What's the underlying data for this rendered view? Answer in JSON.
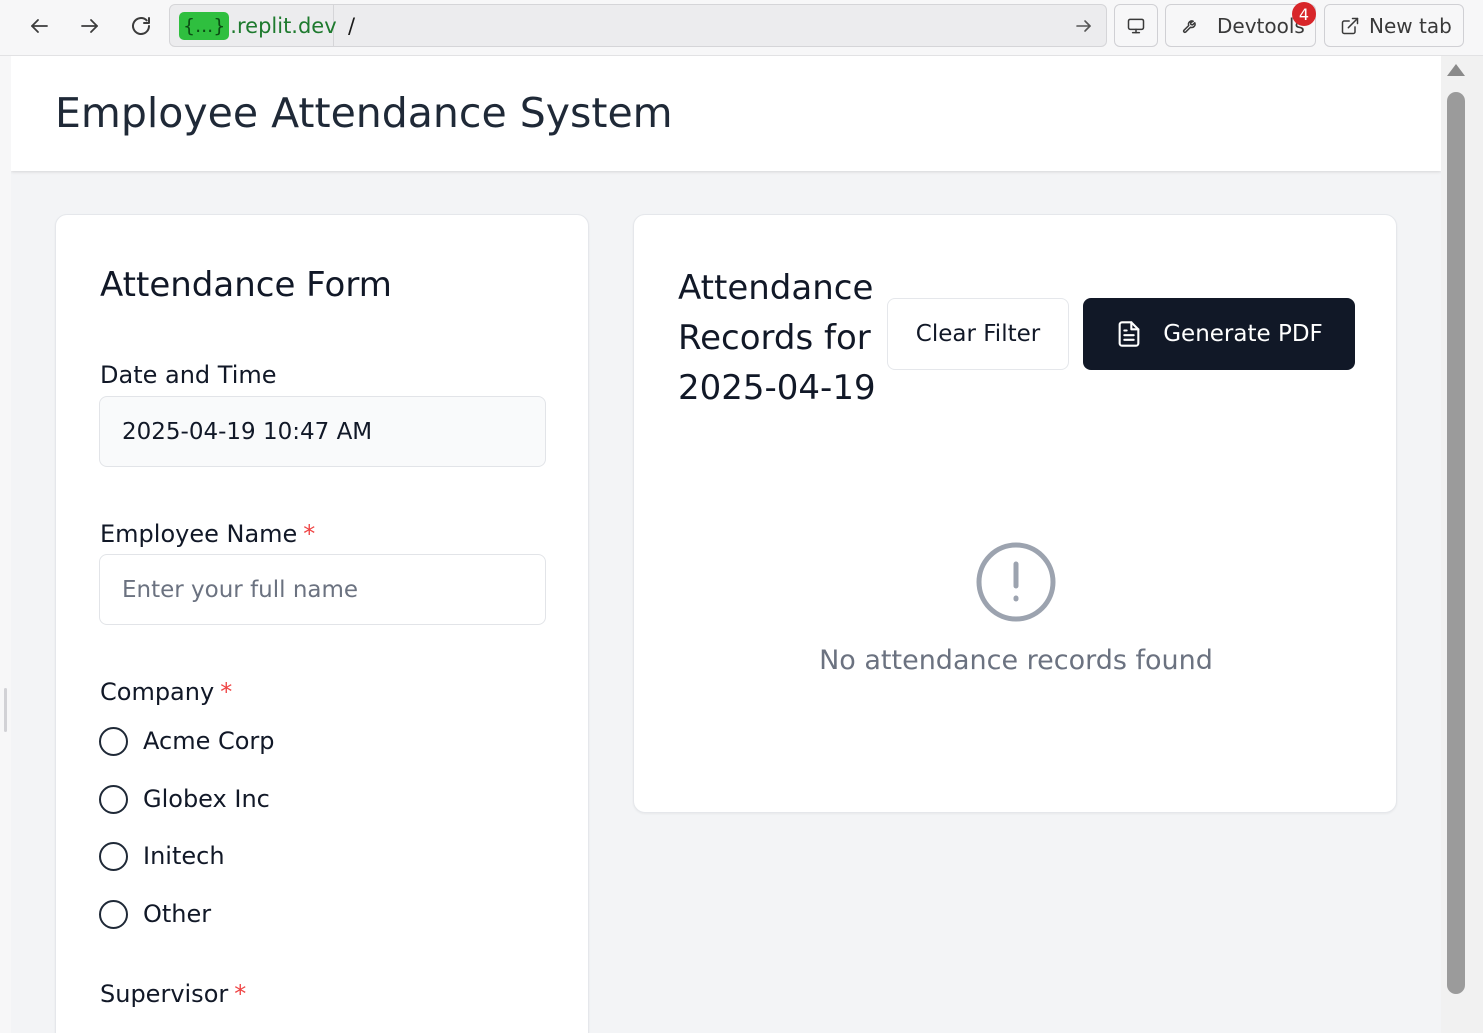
{
  "browser": {
    "url_badge": "{...}",
    "url_host": ".replit.dev",
    "url_path": "/",
    "devtools_label": "Devtools",
    "devtools_badge": "4",
    "new_tab_label": "New tab"
  },
  "app": {
    "title": "Employee Attendance System"
  },
  "form": {
    "heading": "Attendance Form",
    "datetime_label": "Date and Time",
    "datetime_value": "2025-04-19 10:47 AM",
    "name_label": "Employee Name",
    "name_placeholder": "Enter your full name",
    "required_mark": "*",
    "company_label": "Company",
    "company_options": [
      "Acme Corp",
      "Globex Inc",
      "Initech",
      "Other"
    ],
    "supervisor_label": "Supervisor"
  },
  "records": {
    "heading": "Attendance Records for 2025-04-19",
    "clear_filter_label": "Clear Filter",
    "generate_pdf_label": "Generate PDF",
    "empty_message": "No attendance records found"
  },
  "colors": {
    "accent_dark": "#111827",
    "required": "#ef4444",
    "badge_red": "#d8262a",
    "url_badge_green": "#2fbf3f"
  },
  "icons": {
    "back": "arrow-left-icon",
    "forward": "arrow-right-icon",
    "reload": "reload-icon",
    "go": "arrow-right-small-icon",
    "screen": "monitor-icon",
    "devtools": "wrench-icon",
    "new_tab": "external-link-icon",
    "pdf": "file-text-icon",
    "empty": "alert-circle-icon"
  }
}
